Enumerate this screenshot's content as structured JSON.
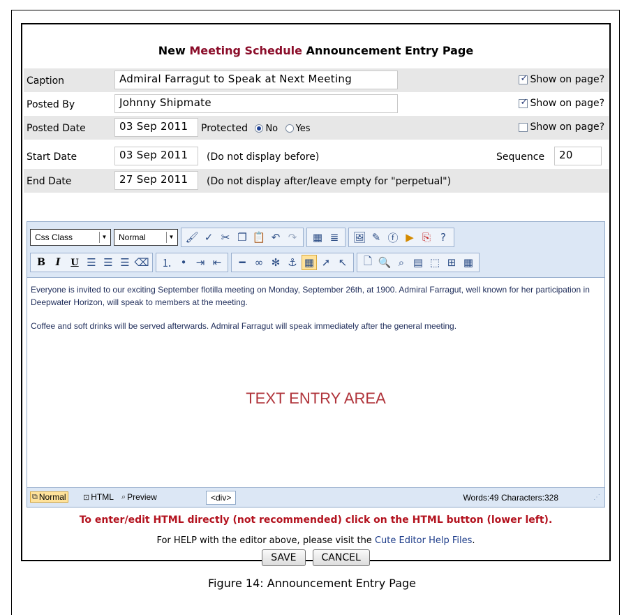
{
  "page": {
    "title_prefix": "New ",
    "title_accent": "Meeting Schedule",
    "title_suffix": " Announcement Entry Page",
    "figure_caption": "Figure 14: Announcement Entry Page"
  },
  "form": {
    "caption": {
      "label": "Caption",
      "value": "Admiral Farragut to Speak at Next Meeting",
      "show_label": "Show on page?",
      "show_checked": true
    },
    "posted_by": {
      "label": "Posted By",
      "value": "Johnny Shipmate",
      "show_label": "Show on page?",
      "show_checked": true
    },
    "posted_date": {
      "label": "Posted Date",
      "value": "03 Sep 2011",
      "protected_label": "Protected",
      "option_no": "No",
      "option_yes": "Yes",
      "protected_selected": "No",
      "show_label": "Show on page?",
      "show_checked": false
    },
    "start_date": {
      "label": "Start Date",
      "value": "03 Sep 2011",
      "note": "(Do not display before)",
      "sequence_label": "Sequence",
      "sequence_value": "20"
    },
    "end_date": {
      "label": "End Date",
      "value": "27 Sep 2011",
      "note": "(Do not display after/leave empty for \"perpetual\")"
    }
  },
  "editor": {
    "css_class_dropdown": "Css Class",
    "format_dropdown": "Normal",
    "content_paragraphs": [
      "Everyone is invited to our exciting September flotilla meeting on Monday, September 26th, at 1900.  Admiral Farragut, well known for her participation in Deepwater Horizon, will speak to members at the meeting.",
      "Coffee and soft drinks will be served afterwards.  Admiral Farragut will speak immediately after the general meeting."
    ],
    "area_label": "TEXT ENTRY AREA",
    "modes": {
      "normal": "Normal",
      "html": "HTML",
      "preview": "Preview",
      "active": "Normal"
    },
    "tag_path": "<div>",
    "words_label": "Words:",
    "words_value": "49",
    "chars_label": "Characters:",
    "chars_value": "328"
  },
  "notes": {
    "html_warning": "To enter/edit HTML directly (not recommended) click on the HTML button (lower left).",
    "help_prefix": "For HELP with the editor above, please visit the ",
    "help_link": "Cute Editor Help Files",
    "help_suffix": "."
  },
  "buttons": {
    "save": "SAVE",
    "cancel": "CANCEL"
  },
  "colors": {
    "title_accent": "#8b0d2a",
    "warning": "#b3121e",
    "toolbar_bg": "#dce7f5",
    "row_shade": "#e7e7e7"
  }
}
